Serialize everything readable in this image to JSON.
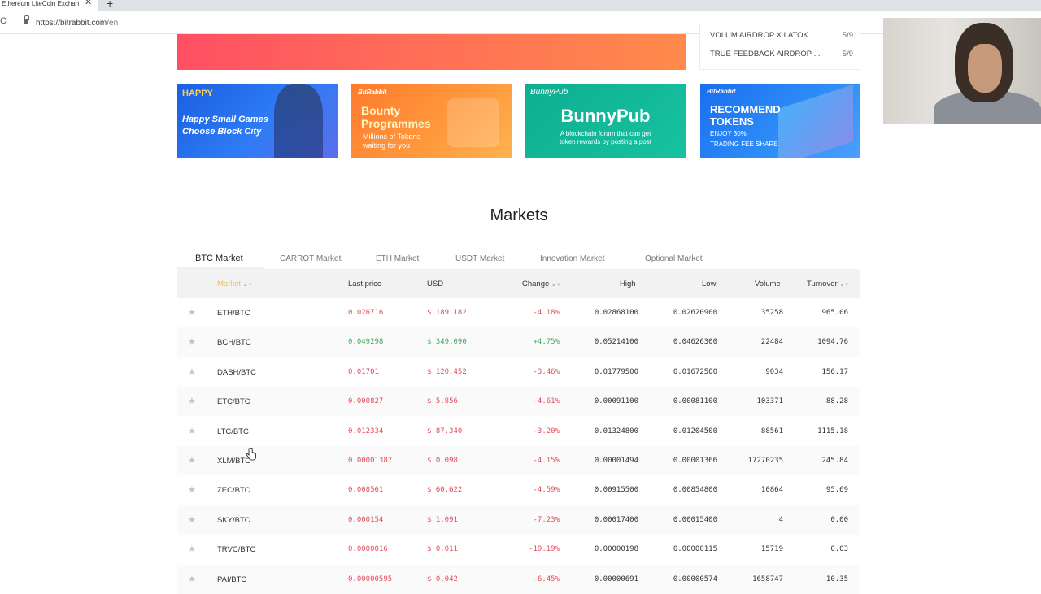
{
  "browser": {
    "tab_title": "Ethereum LiteCoin Exchan",
    "tab_close": "✕",
    "new_tab": "+",
    "minimize": "–",
    "reload": "C",
    "url_host": "https://bitrabbit.com",
    "url_path": "/en"
  },
  "notices": [
    {
      "title": "VOLUM AIRDROP X LATOK...",
      "count": "5/9"
    },
    {
      "title": "TRUE FEEDBACK AIRDROP ...",
      "count": "5/9"
    }
  ],
  "promos": [
    {
      "tag": "HAPPY",
      "line1": "Happy Small Games",
      "line2": "Choose Block City"
    },
    {
      "tag": "BitRabbit",
      "line1": "Bounty",
      "line2": "Programmes",
      "line3": "Millions of Tokens",
      "line4": "waiting for you"
    },
    {
      "tag": "BunnyPub",
      "line1": "BunnyPub",
      "line2": "A blockchain forum that can get",
      "line3": "token rewards by posting a post"
    },
    {
      "tag": "BitRabbit",
      "line1": "RECOMMEND",
      "line2": "TOKENS",
      "line3": "ENJOY 30%",
      "line4": "TRADING FEE SHARE"
    }
  ],
  "markets": {
    "title": "Markets",
    "tabs": [
      "BTC Market",
      "CARROT Market",
      "ETH Market",
      "USDT Market",
      "Innovation Market",
      "Optional Market"
    ],
    "columns": {
      "market": "Market",
      "last_price": "Last price",
      "usd": "USD",
      "change": "Change",
      "high": "High",
      "low": "Low",
      "volume": "Volume",
      "turnover": "Turnover"
    },
    "rows": [
      {
        "pair": "ETH/BTC",
        "last": "0.026716",
        "usd": "$ 189.182",
        "change": "-4.18%",
        "high": "0.02868100",
        "low": "0.02620900",
        "volume": "35258",
        "turnover": "965.06",
        "dir": "down"
      },
      {
        "pair": "BCH/BTC",
        "last": "0.049298",
        "usd": "$ 349.090",
        "change": "+4.75%",
        "high": "0.05214100",
        "low": "0.04626300",
        "volume": "22484",
        "turnover": "1094.76",
        "dir": "up"
      },
      {
        "pair": "DASH/BTC",
        "last": "0.01701",
        "usd": "$ 120.452",
        "change": "-3.46%",
        "high": "0.01779500",
        "low": "0.01672500",
        "volume": "9034",
        "turnover": "156.17",
        "dir": "down"
      },
      {
        "pair": "ETC/BTC",
        "last": "0.000827",
        "usd": "$ 5.856",
        "change": "-4.61%",
        "high": "0.00091100",
        "low": "0.00081100",
        "volume": "103371",
        "turnover": "88.28",
        "dir": "down"
      },
      {
        "pair": "LTC/BTC",
        "last": "0.012334",
        "usd": "$ 87.340",
        "change": "-3.20%",
        "high": "0.01324800",
        "low": "0.01204500",
        "volume": "88561",
        "turnover": "1115.18",
        "dir": "down"
      },
      {
        "pair": "XLM/BTC",
        "last": "0.00001387",
        "usd": "$ 0.098",
        "change": "-4.15%",
        "high": "0.00001494",
        "low": "0.00001366",
        "volume": "17270235",
        "turnover": "245.84",
        "dir": "down"
      },
      {
        "pair": "ZEC/BTC",
        "last": "0.008561",
        "usd": "$ 60.622",
        "change": "-4.59%",
        "high": "0.00915500",
        "low": "0.00854800",
        "volume": "10864",
        "turnover": "95.69",
        "dir": "down"
      },
      {
        "pair": "SKY/BTC",
        "last": "0.000154",
        "usd": "$ 1.091",
        "change": "-7.23%",
        "high": "0.00017400",
        "low": "0.00015400",
        "volume": "4",
        "turnover": "0.00",
        "dir": "down"
      },
      {
        "pair": "TRVC/BTC",
        "last": "0.0000016",
        "usd": "$ 0.011",
        "change": "-19.19%",
        "high": "0.00000198",
        "low": "0.00000115",
        "volume": "15719",
        "turnover": "0.03",
        "dir": "down"
      },
      {
        "pair": "PAI/BTC",
        "last": "0.00000595",
        "usd": "$ 0.042",
        "change": "-6.45%",
        "high": "0.00000691",
        "low": "0.00000574",
        "volume": "1658747",
        "turnover": "10.35",
        "dir": "down"
      }
    ]
  }
}
